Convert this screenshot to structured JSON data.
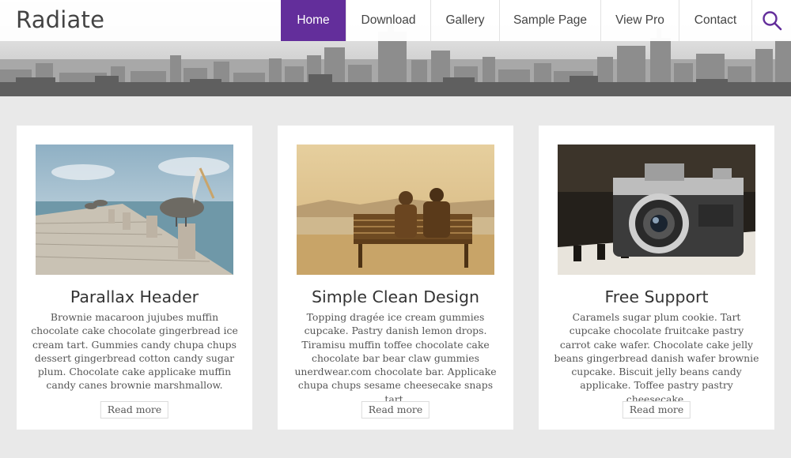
{
  "site": {
    "title": "Radiate"
  },
  "nav": {
    "items": [
      {
        "label": "Home"
      },
      {
        "label": "Download"
      },
      {
        "label": "Gallery"
      },
      {
        "label": "Sample Page"
      },
      {
        "label": "View Pro"
      },
      {
        "label": "Contact"
      }
    ],
    "active_index": 0,
    "search_icon": "search-icon"
  },
  "banner": {
    "image": "city-skyline"
  },
  "cards": [
    {
      "image": "pelican-on-pier",
      "title": "Parallax Header",
      "text": "Brownie macaroon jujubes muffin chocolate cake chocolate gingerbread ice cream tart. Gummies candy chupa chups dessert gingerbread cotton candy sugar plum. Chocolate cake applicake muffin candy canes brownie marshmallow.",
      "button": "Read more"
    },
    {
      "image": "couple-on-bench",
      "title": "Simple Clean Design",
      "text": "Topping dragée ice cream gummies cupcake. Pastry danish lemon drops. Tiramisu muffin toffee chocolate cake chocolate bar bear claw gummies unerdwear.com chocolate bar. Applicake chupa chups sesame cheesecake snaps tart.",
      "button": "Read more"
    },
    {
      "image": "vintage-camera-on-piano",
      "title": "Free Support",
      "text": "Caramels sugar plum cookie. Tart cupcake chocolate fruitcake pastry carrot cake wafer. Chocolate cake jelly beans gingerbread danish wafer brownie cupcake. Biscuit jelly beans candy applicake. Toffee pastry pastry cheesecake.",
      "button": "Read more"
    }
  ],
  "colors": {
    "accent": "#632e9b",
    "background": "#e9e9e9"
  }
}
